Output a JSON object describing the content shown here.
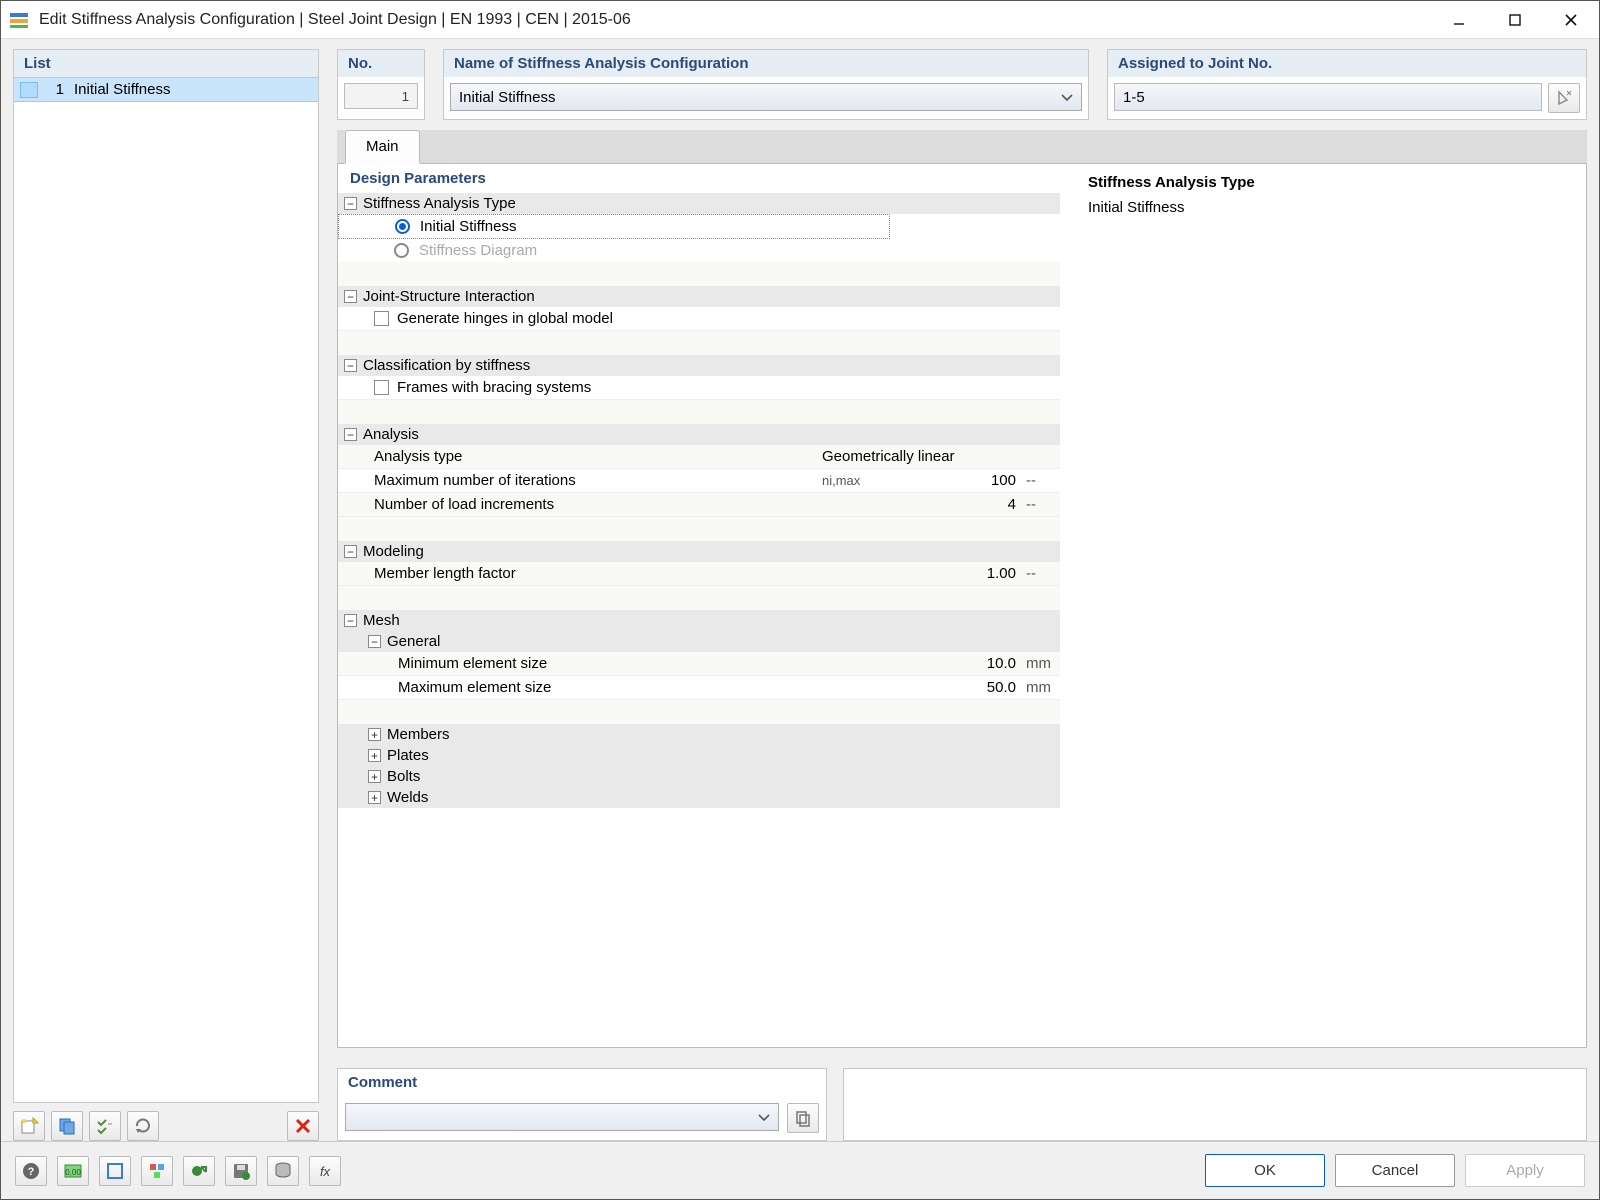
{
  "window": {
    "title": "Edit Stiffness Analysis Configuration | Steel Joint Design | EN 1993 | CEN | 2015-06"
  },
  "list": {
    "header": "List",
    "items": [
      {
        "no": "1",
        "name": "Initial Stiffness"
      }
    ]
  },
  "fields": {
    "no_label": "No.",
    "no_value": "1",
    "name_label": "Name of Stiffness Analysis Configuration",
    "name_value": "Initial Stiffness",
    "assigned_label": "Assigned to Joint No.",
    "assigned_value": "1-5"
  },
  "tabs": {
    "main": "Main"
  },
  "params": {
    "title": "Design Parameters",
    "stiffness_type": {
      "label": "Stiffness Analysis Type",
      "opt_initial": "Initial Stiffness",
      "opt_diagram": "Stiffness Diagram"
    },
    "joint_structure": {
      "label": "Joint-Structure Interaction",
      "generate_hinges": "Generate hinges in global model"
    },
    "classification": {
      "label": "Classification by stiffness",
      "frames_bracing": "Frames with bracing systems"
    },
    "analysis": {
      "label": "Analysis",
      "analysis_type_lbl": "Analysis type",
      "analysis_type_val": "Geometrically linear",
      "max_iter_lbl": "Maximum number of iterations",
      "max_iter_sym": "ni,max",
      "max_iter_val": "100",
      "max_iter_unit": "--",
      "load_incr_lbl": "Number of load increments",
      "load_incr_val": "4",
      "load_incr_unit": "--"
    },
    "modeling": {
      "label": "Modeling",
      "member_len_lbl": "Member length factor",
      "member_len_val": "1.00",
      "member_len_unit": "--"
    },
    "mesh": {
      "label": "Mesh",
      "general_label": "General",
      "min_elem_lbl": "Minimum element size",
      "min_elem_val": "10.0",
      "min_elem_unit": "mm",
      "max_elem_lbl": "Maximum element size",
      "max_elem_val": "50.0",
      "max_elem_unit": "mm",
      "members_label": "Members",
      "plates_label": "Plates",
      "bolts_label": "Bolts",
      "welds_label": "Welds"
    }
  },
  "info": {
    "title": "Stiffness Analysis Type",
    "text": "Initial Stiffness"
  },
  "comment": {
    "label": "Comment",
    "value": ""
  },
  "buttons": {
    "ok": "OK",
    "cancel": "Cancel",
    "apply": "Apply"
  }
}
